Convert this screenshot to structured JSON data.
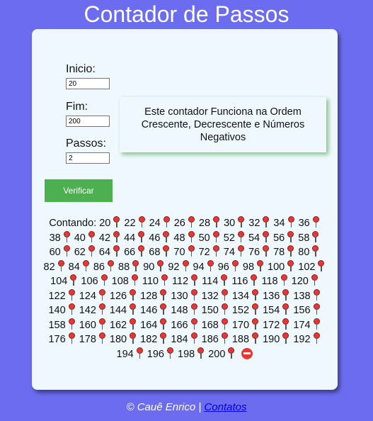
{
  "header": {
    "title": "Contador de Passos"
  },
  "form": {
    "start_label": "Inicio:",
    "start_value": "20",
    "end_label": "Fim:",
    "end_value": "200",
    "step_label": "Passos:",
    "step_value": "2",
    "verify_label": "Verificar"
  },
  "info": {
    "text": "Este contador Funciona na Ordem Crescente, Decrescente e Números Negativos"
  },
  "result": {
    "prefix": "Contando:",
    "steps": [
      "20",
      "22",
      "24",
      "26",
      "28",
      "30",
      "32",
      "34",
      "36",
      "38",
      "40",
      "42",
      "44",
      "46",
      "48",
      "50",
      "52",
      "54",
      "56",
      "58",
      "60",
      "62",
      "64",
      "66",
      "68",
      "70",
      "72",
      "74",
      "76",
      "78",
      "80",
      "82",
      "84",
      "86",
      "88",
      "90",
      "92",
      "94",
      "96",
      "98",
      "100",
      "102",
      "104",
      "106",
      "108",
      "110",
      "112",
      "114",
      "116",
      "118",
      "120",
      "122",
      "124",
      "126",
      "128",
      "130",
      "132",
      "134",
      "136",
      "138",
      "140",
      "142",
      "144",
      "146",
      "148",
      "150",
      "152",
      "154",
      "156",
      "158",
      "160",
      "162",
      "164",
      "166",
      "168",
      "170",
      "172",
      "174",
      "176",
      "178",
      "180",
      "182",
      "184",
      "186",
      "188",
      "190",
      "192",
      "194",
      "196",
      "198",
      "200"
    ],
    "step_icon": "pushpin-icon",
    "end_icon": "no-entry-icon"
  },
  "footer": {
    "copyright": "© Cauê Enrico |",
    "contact_link": "Contatos"
  },
  "colors": {
    "background": "#6c6cf0",
    "card": "#f0f8ff",
    "button": "#4caf50",
    "link": "#0000ee"
  }
}
